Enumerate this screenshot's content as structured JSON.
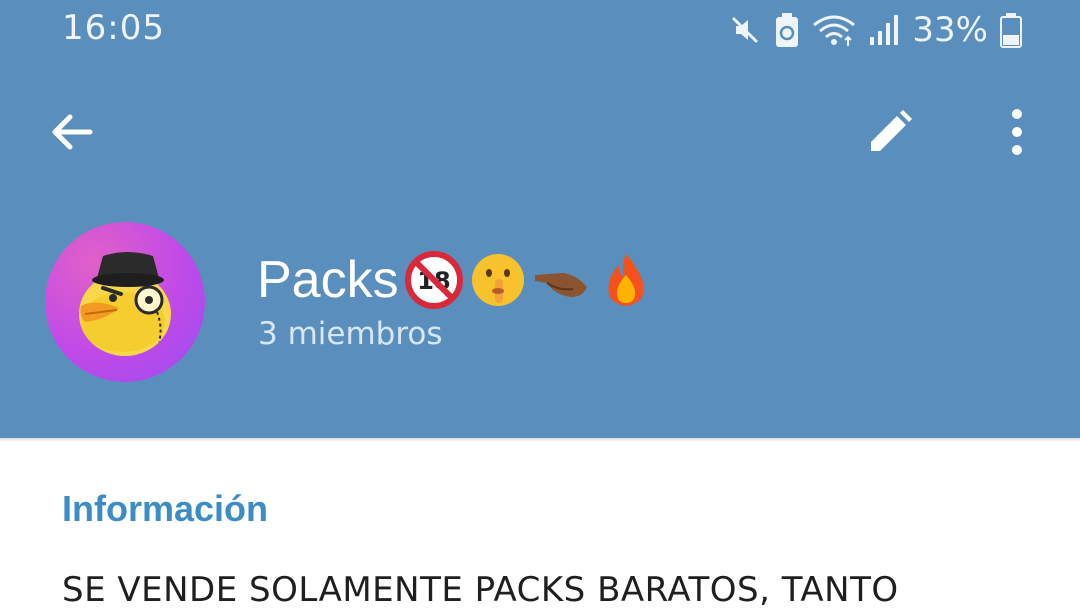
{
  "status_bar": {
    "time": "16:05",
    "battery_percent": "33%",
    "icons": [
      "mute-icon",
      "battery-saver-icon",
      "wifi-icon",
      "signal-icon",
      "battery-icon"
    ]
  },
  "toolbar": {
    "back_icon": "arrow-left-icon",
    "edit_icon": "pencil-icon",
    "more_icon": "more-vertical-icon"
  },
  "profile": {
    "avatar": "duck-with-top-hat-and-monocle",
    "name": "Packs",
    "name_emojis": [
      "no-under-18-icon",
      "shushing-face-icon",
      "pointing-hand-icon",
      "fire-icon"
    ],
    "members": "3 miembros"
  },
  "info": {
    "section_title": "Información",
    "description": "SE VENDE SOLAMENTE PACKS BARATOS, TANTO"
  },
  "colors": {
    "header_bg": "#5a8fbd",
    "accent": "#3c8cc6",
    "text": "#1f1f1f"
  }
}
